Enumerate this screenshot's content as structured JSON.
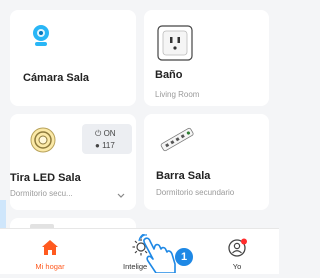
{
  "devices": [
    {
      "title": "Cámara Sala",
      "subtitle": "",
      "icon": "camera-icon"
    },
    {
      "title": "Baño",
      "subtitle": "Living Room",
      "icon": "smart-plug-icon"
    },
    {
      "title": "Tira LED Sala",
      "subtitle": "Dormitorio secu...",
      "icon": "led-strip-icon",
      "status": {
        "power": "ON",
        "value": "117"
      }
    },
    {
      "title": "Barra Sala",
      "subtitle": "Dormitorio secundario",
      "icon": "power-strip-icon"
    }
  ],
  "tabbar": {
    "items": [
      {
        "label": "Mi hogar",
        "icon": "home-icon",
        "active": true
      },
      {
        "label": "Intelige",
        "icon": "smart-icon",
        "active": false
      },
      {
        "label": "Yo",
        "icon": "profile-icon",
        "active": false
      }
    ]
  },
  "annotation": {
    "step": "1"
  },
  "colors": {
    "accent": "#ff5a1f",
    "background": "#f4f5f7",
    "card": "#ffffff",
    "annotation": "#1e88e5"
  }
}
